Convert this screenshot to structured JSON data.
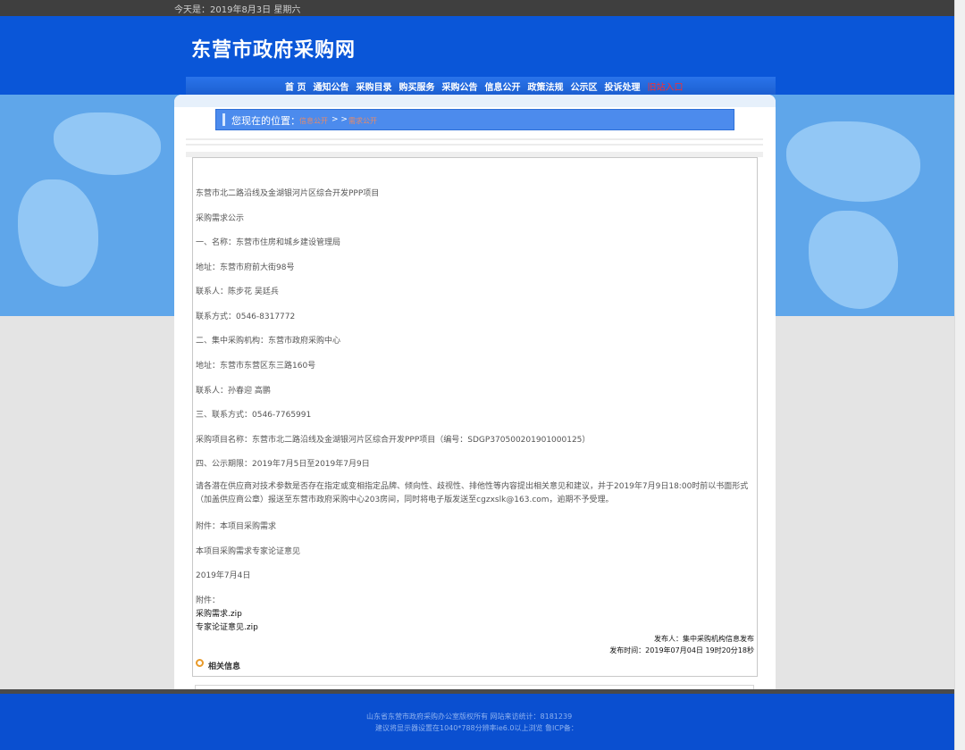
{
  "topbar": {
    "date": "今天是：2019年8月3日 星期六"
  },
  "site": {
    "title": "东营市政府采购网"
  },
  "nav": {
    "items": [
      {
        "label": "首 页"
      },
      {
        "label": "通知公告"
      },
      {
        "label": "采购目录"
      },
      {
        "label": "购买服务"
      },
      {
        "label": "采购公告"
      },
      {
        "label": "信息公开"
      },
      {
        "label": "政策法规"
      },
      {
        "label": "公示区"
      },
      {
        "label": "投诉处理"
      },
      {
        "label": "旧站入口"
      }
    ]
  },
  "breadcrumb": {
    "label": "您现在的位置：",
    "link1": "信息公开",
    "separator": "> >",
    "link2": "需求公开"
  },
  "article": {
    "paragraphs": [
      "东营市北二路沿线及金湖银河片区综合开发PPP项目",
      "采购需求公示",
      "一、名称：东营市住房和城乡建设管理局",
      "地址：东营市府前大街98号",
      "联系人：陈步花 吴廷兵",
      "联系方式：0546-8317772",
      "二、集中采购机构：东营市政府采购中心",
      "地址：东营市东营区东三路160号",
      "联系人：孙春迎 高鹏",
      "三、联系方式：0546-7765991",
      "采购项目名称：东营市北二路沿线及金湖银河片区综合开发PPP项目（编号：SDGP370500201901000125）",
      "四、公示期限：2019年7月5日至2019年7月9日",
      "请各潜在供应商对技术参数是否存在指定或变相指定品牌、倾向性、歧视性、排他性等内容提出相关意见和建议，并于2019年7月9日18:00时前以书面形式（加盖供应商公章）报送至东营市政府采购中心203房间，同时将电子版发送至cgzxslk@163.com，逾期不予受理。",
      "附件：本项目采购需求",
      "本项目采购需求专家论证意见",
      "2019年7月4日"
    ],
    "attachments_label": "附件：",
    "attachments": [
      "采购需求.zip",
      "专家论证意见.zip"
    ],
    "publisher": "发布人：集中采购机构信息发布",
    "publish_time": "发布时间：2019年07月04日 19时20分18秒"
  },
  "related": {
    "label": "相关信息"
  },
  "footer": {
    "line1": "山东省东营市政府采购办公室版权所有        网站来访统计：8181239",
    "line2": "建议将显示器设置在1040*788分辨率ie6.0以上浏览 鲁ICP备："
  },
  "colors": {
    "header_blue": "#0a56d8",
    "nav_alert": "#ff2b2b",
    "breadcrumb_blue": "#4c8bed",
    "footer_blue": "#0a4fd0"
  }
}
